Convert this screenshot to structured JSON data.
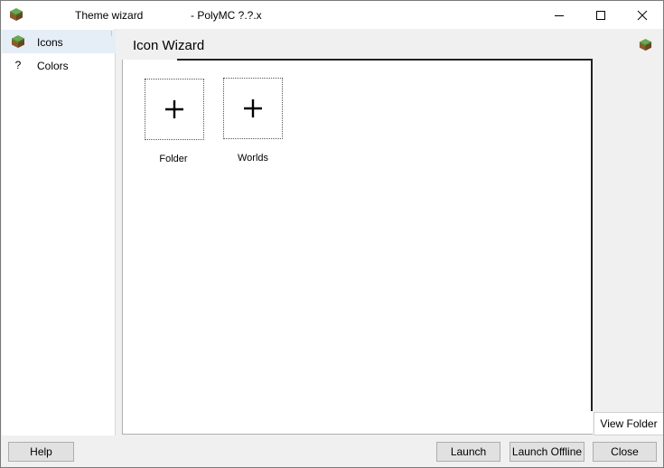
{
  "window": {
    "title": "Theme wizard",
    "subtitle": "- PolyMC ?.?.x",
    "app_icon": "grass-block-icon",
    "controls": [
      "minimize-icon",
      "maximize-icon",
      "close-icon"
    ]
  },
  "sidebar": {
    "items": [
      {
        "label": "Icons",
        "icon": "grass-block-icon",
        "selected": true
      },
      {
        "label": "Colors",
        "icon": "?",
        "selected": false
      }
    ]
  },
  "page": {
    "title": "Icon Wizard",
    "header_icon": "grass-block-icon",
    "tiles": [
      {
        "label": "Folder",
        "icon": "+"
      },
      {
        "label": "Worlds",
        "icon": "+"
      }
    ],
    "view_folder_label": "View Folder"
  },
  "footer": {
    "help_label": "Help",
    "launch_label": "Launch",
    "launch_offline_label": "Launch Offline",
    "close_label": "Close"
  },
  "colors": {
    "selected_bg": "#e5eef7",
    "grass_top": "#6aa84f",
    "dirt": "#8b5a2b"
  }
}
